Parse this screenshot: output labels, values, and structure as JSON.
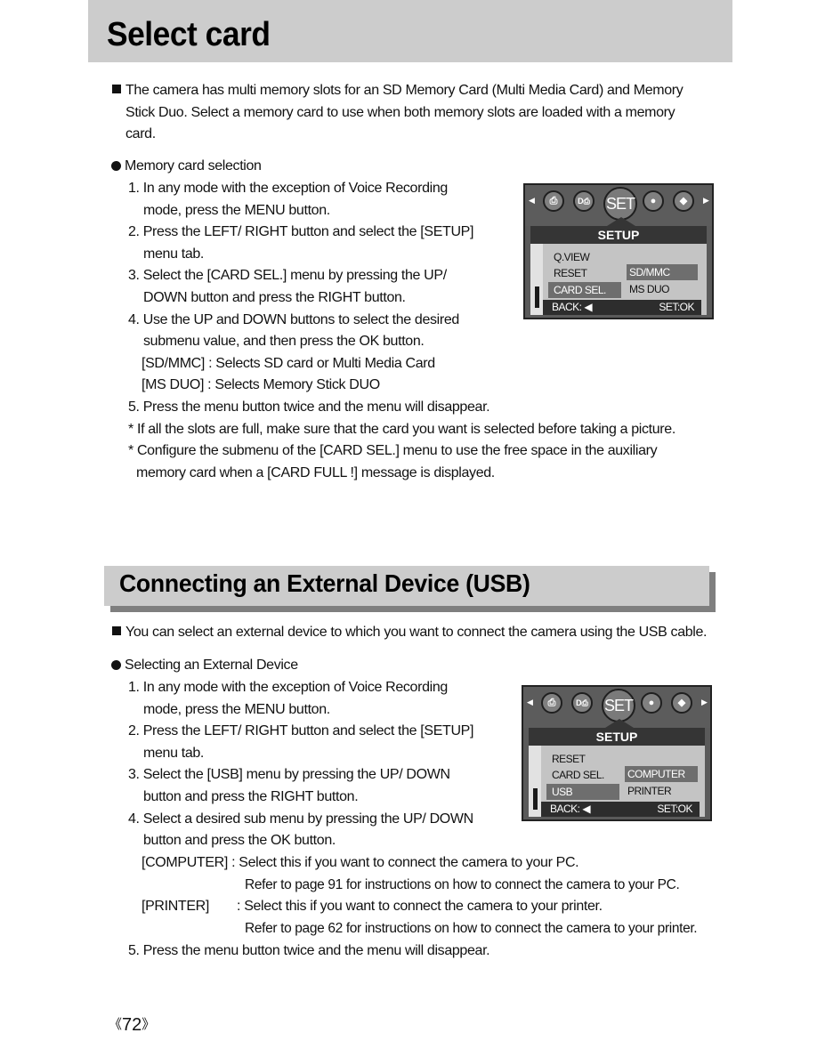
{
  "section1": {
    "title": "Select card",
    "intro": [
      "The camera has multi memory slots for an SD Memory Card (Multi Media Card) and Memory",
      "Stick Duo. Select a memory card to use when both memory slots are loaded with a memory",
      "card."
    ],
    "subheading": "Memory card selection",
    "lines": [
      "1. In any mode with the exception of Voice Recording",
      "mode, press the MENU button.",
      "2. Press the LEFT/ RIGHT button and select the [SETUP]",
      "menu tab.",
      "3. Select the [CARD SEL.] menu by pressing the UP/",
      "DOWN button and press the RIGHT button.",
      "4. Use the UP and DOWN buttons to select the desired",
      "submenu value, and then press the OK button.",
      "[SD/MMC]  : Selects SD card or Multi Media Card",
      "[MS DUO]  : Selects Memory Stick DUO",
      "5. Press the menu button twice and the menu will disappear.",
      "* If all the slots are full, make sure that the card you want is selected before taking a picture.",
      "* Configure the submenu of the [CARD SEL.] menu to use the free space in the auxiliary",
      "memory card when a [CARD FULL !] message is displayed."
    ],
    "screen": {
      "tab_center": "SET",
      "menu_title": "SETUP",
      "menu_items": [
        "Q.VIEW",
        "RESET",
        "CARD SEL."
      ],
      "selected_item": "CARD SEL.",
      "submenu": [
        "SD/MMC",
        "MS DUO"
      ],
      "selected_sub": "SD/MMC",
      "back_label": "BACK: ◀",
      "set_label": "SET:OK"
    }
  },
  "section2": {
    "title": "Connecting an External Device (USB)",
    "intro": "You can select an external device to which you want to connect the camera using the USB cable.",
    "subheading": "Selecting an External Device",
    "lines": [
      "1. In any mode with the exception of Voice Recording",
      "mode, press the MENU button.",
      "2. Press the LEFT/ RIGHT button and select the [SETUP]",
      "menu tab.",
      "3. Select the [USB] menu by pressing the UP/ DOWN",
      "button and press the RIGHT button.",
      "4. Select a desired sub menu by pressing the UP/ DOWN",
      "button and press the OK button."
    ],
    "options": [
      {
        "key": "[COMPUTER]",
        "desc": ": Select this if you want to connect the camera to your PC.",
        "note": "Refer to page 91 for instructions on how to connect the camera to your PC."
      },
      {
        "key": "[PRINTER]",
        "desc": ": Select this if you want to connect the camera to your printer.",
        "note": "Refer to page 62 for instructions on how to connect the camera to your printer."
      }
    ],
    "final": "5. Press the menu button twice and the menu will disappear.",
    "screen": {
      "tab_center": "SET",
      "menu_title": "SETUP",
      "menu_items": [
        "RESET",
        "CARD SEL.",
        "USB"
      ],
      "selected_item": "USB",
      "submenu": [
        "COMPUTER",
        "PRINTER"
      ],
      "selected_sub": "COMPUTER",
      "back_label": "BACK: ◀",
      "set_label": "SET:OK"
    }
  },
  "icons": {
    "tabs": [
      "print-icon",
      "transfer-icon",
      "set-icon",
      "user-icon",
      "effect-icon"
    ]
  },
  "footer": {
    "left_bracket": "《",
    "page_number": "72",
    "right_bracket": "》"
  }
}
